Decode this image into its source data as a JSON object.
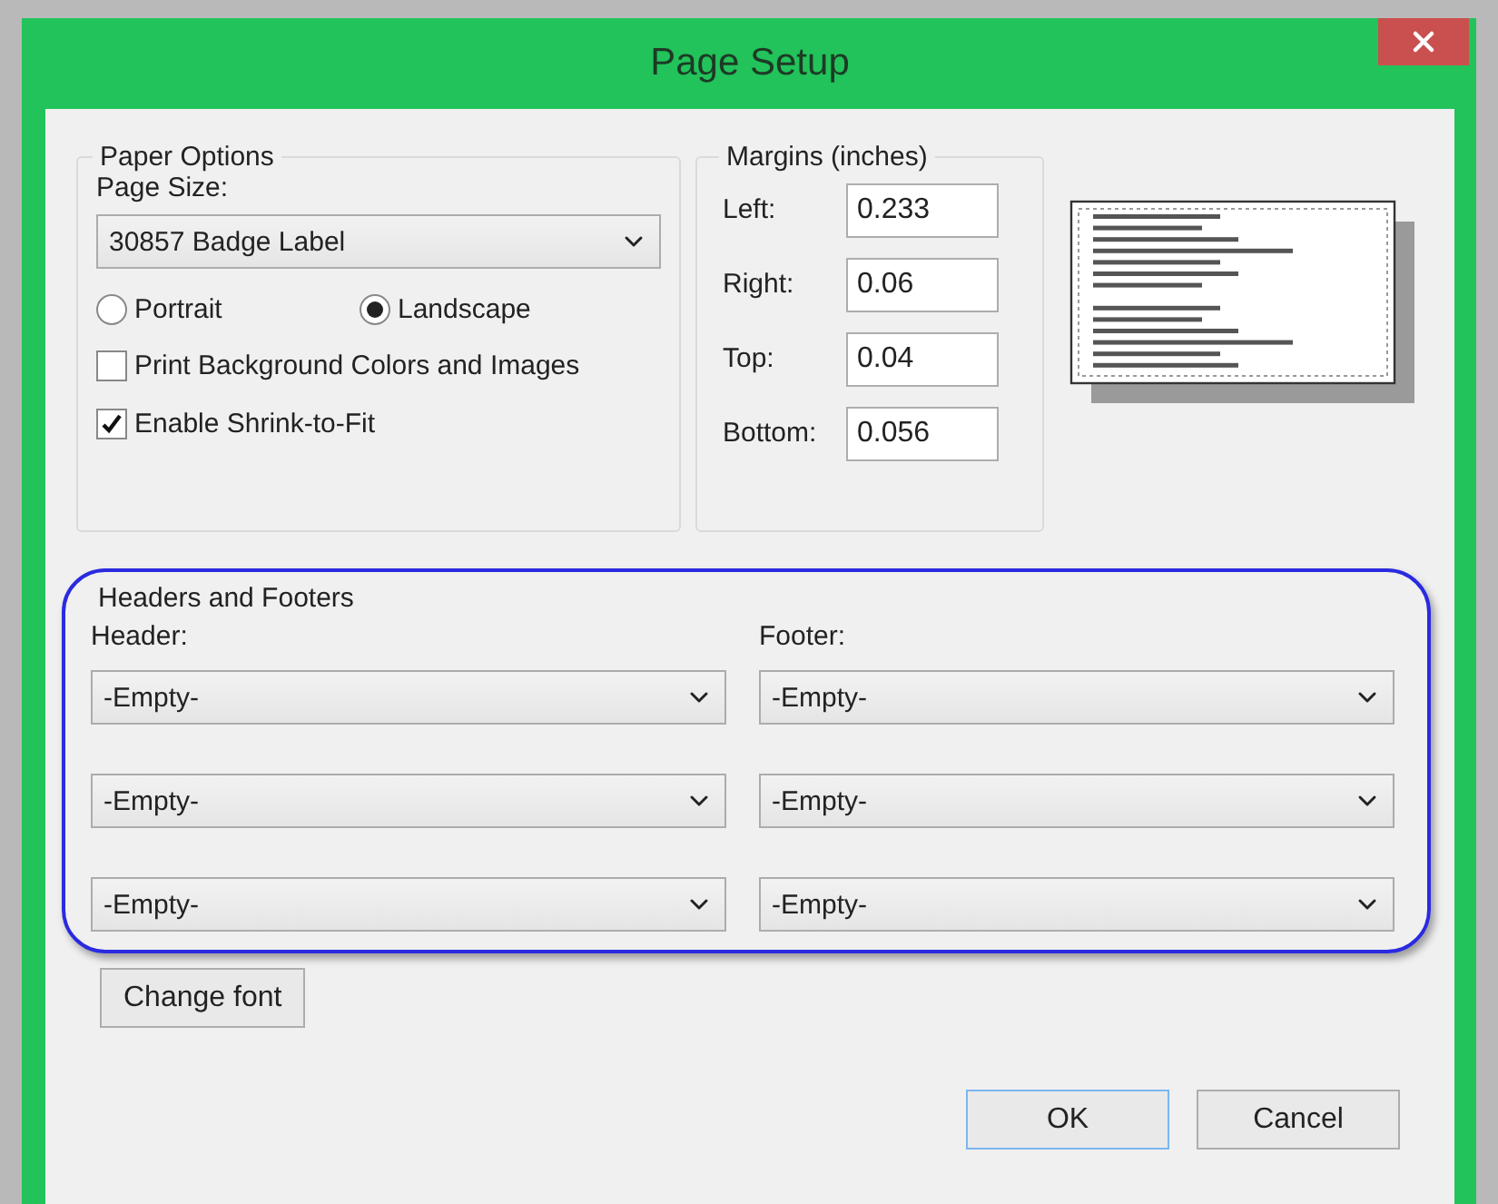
{
  "window": {
    "title": "Page Setup"
  },
  "paper_options": {
    "title": "Paper Options",
    "page_size_label": "Page Size:",
    "page_size": "30857 Badge Label",
    "orientation": [
      {
        "label": "Portrait",
        "selected": false
      },
      {
        "label": "Landscape",
        "selected": true
      }
    ],
    "checkboxes": [
      {
        "label": "Print Background Colors and Images",
        "checked": false
      },
      {
        "label": "Enable Shrink-to-Fit",
        "checked": true
      }
    ]
  },
  "margins": {
    "title": "Margins (inches)",
    "fields": [
      {
        "label": "Left:",
        "value": "0.233"
      },
      {
        "label": "Right:",
        "value": "0.06"
      },
      {
        "label": "Top:",
        "value": "0.04"
      },
      {
        "label": "Bottom:",
        "value": "0.056"
      }
    ]
  },
  "headers_footers": {
    "title": "Headers and Footers",
    "header_label": "Header:",
    "footer_label": "Footer:",
    "header": [
      "-Empty-",
      "-Empty-",
      "-Empty-"
    ],
    "footer": [
      "-Empty-",
      "-Empty-",
      "-Empty-"
    ],
    "change_font": "Change font"
  },
  "buttons": [
    {
      "label": "OK",
      "default": true
    },
    {
      "label": "Cancel",
      "default": false
    }
  ]
}
